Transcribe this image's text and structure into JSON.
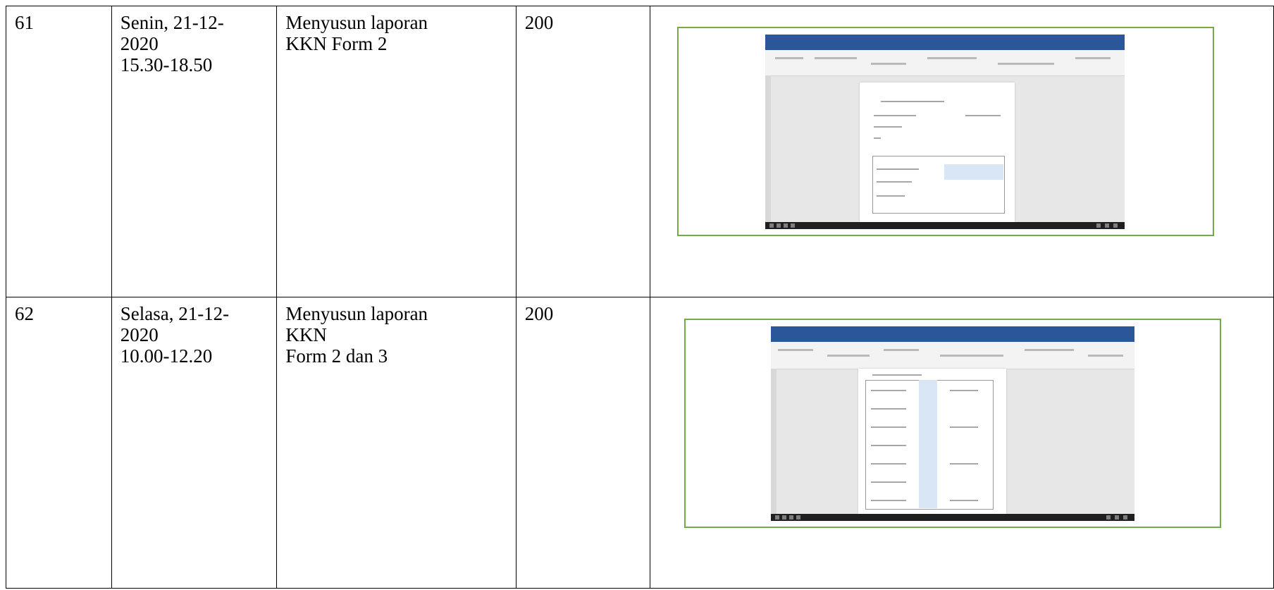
{
  "rows": [
    {
      "no": "61",
      "date": "Senin, 21-12-\n2020\n15.30-18.50",
      "activity": "Menyusun laporan\nKKN Form 2",
      "duration": "200",
      "screenshot": "document-editor-screenshot"
    },
    {
      "no": "62",
      "date": "Selasa, 21-12-\n2020\n10.00-12.20",
      "activity": "Menyusun laporan\nKKN\nForm 2 dan 3",
      "duration": "200",
      "screenshot": "document-editor-screenshot"
    }
  ],
  "colors": {
    "frame_border": "#70ad47",
    "titlebar": "#2b579a",
    "taskbar": "#1f1f1f"
  }
}
